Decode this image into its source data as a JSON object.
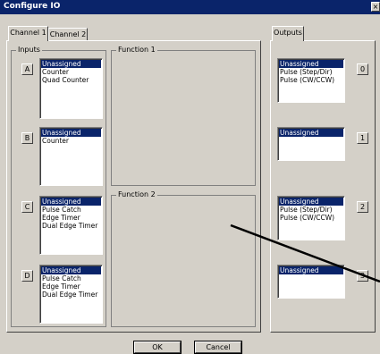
{
  "window": {
    "title": "Configure IO",
    "close": "×"
  },
  "tabs": [
    "Channel 1",
    "Channel 2"
  ],
  "outputs_tab": "Outputs",
  "inputs_label": "Inputs",
  "function1_label": "Function 1",
  "function2_label": "Function 2",
  "inputs": [
    {
      "letter": "A",
      "items": [
        "Unassigned",
        "Counter",
        "Quad Counter"
      ],
      "selected": 0
    },
    {
      "letter": "B",
      "items": [
        "Unassigned",
        "Counter"
      ],
      "selected": 0
    },
    {
      "letter": "C",
      "items": [
        "Unassigned",
        "Pulse Catch",
        "Edge Timer",
        "Dual Edge Timer"
      ],
      "selected": 0
    },
    {
      "letter": "D",
      "items": [
        "Unassigned",
        "Pulse Catch",
        "Edge Timer",
        "Dual Edge Timer"
      ],
      "selected": 0
    }
  ],
  "outputs": [
    {
      "letter": "0",
      "items": [
        "Unassigned",
        "Pulse (Step/Dir)",
        "Pulse (CW/CCW)"
      ],
      "selected": 0
    },
    {
      "letter": "1",
      "items": [
        "Unassigned"
      ],
      "selected": 0
    },
    {
      "letter": "2",
      "items": [
        "Unassigned",
        "Pulse (Step/Dir)",
        "Pulse (CW/CCW)"
      ],
      "selected": 0
    },
    {
      "letter": "3",
      "items": [
        "Unassigned"
      ],
      "selected": 0
    }
  ],
  "buttons": {
    "ok": "OK",
    "cancel": "Cancel"
  }
}
